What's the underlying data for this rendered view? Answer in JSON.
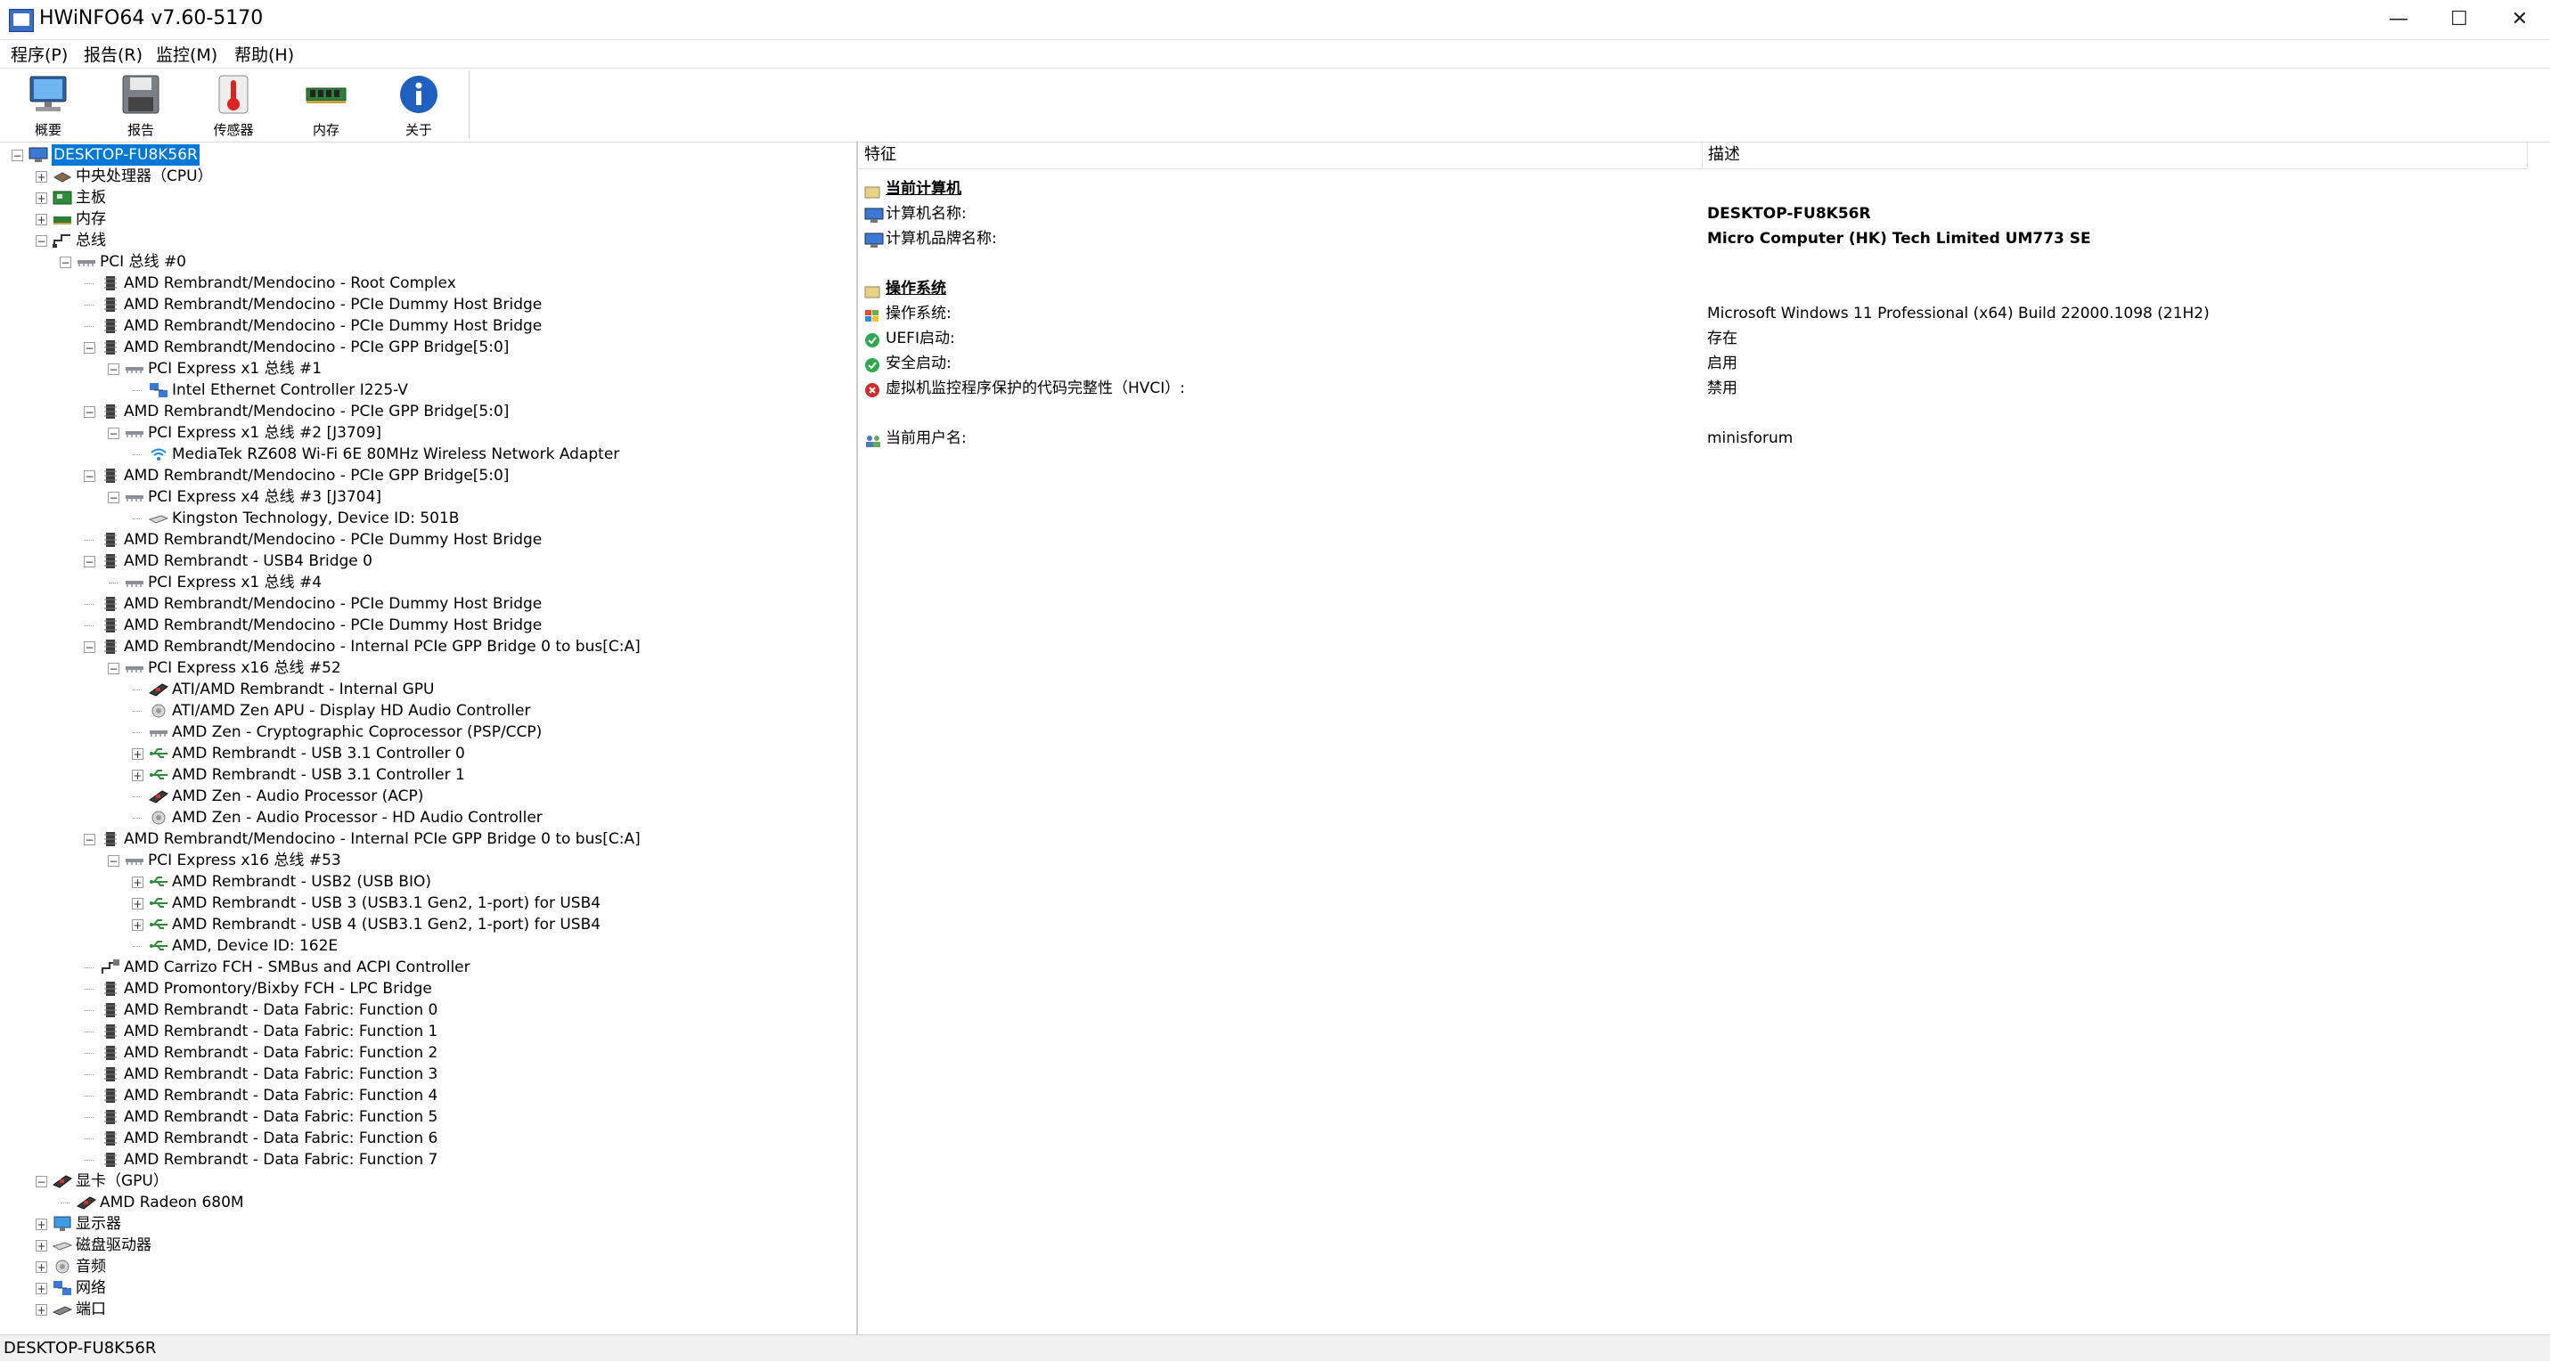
{
  "window": {
    "title": "HWiNFO64 v7.60-5170",
    "minimize": "—",
    "maximize": "☐",
    "close": "✕"
  },
  "menu": [
    "程序(P)",
    "报告(R)",
    "监控(M)",
    "帮助(H)"
  ],
  "toolbar": [
    {
      "label": "概要",
      "icon": "computer-icon"
    },
    {
      "label": "报告",
      "icon": "save-disk-icon"
    },
    {
      "label": "传感器",
      "icon": "thermometer-icon"
    },
    {
      "label": "内存",
      "icon": "memory-module-icon"
    },
    {
      "label": "关于",
      "icon": "info-icon"
    }
  ],
  "tree": [
    {
      "label": "DESKTOP-FU8K56R",
      "level": 0,
      "exp": "-",
      "icon": "computer",
      "selected": true
    },
    {
      "label": "中央处理器（CPU）",
      "level": 1,
      "exp": "+",
      "icon": "cpu"
    },
    {
      "label": "主板",
      "level": 1,
      "exp": "+",
      "icon": "board"
    },
    {
      "label": "内存",
      "level": 1,
      "exp": "+",
      "icon": "ram"
    },
    {
      "label": "总线",
      "level": 1,
      "exp": "-",
      "icon": "bus"
    },
    {
      "label": "PCI 总线 #0",
      "level": 2,
      "exp": "-",
      "icon": "pcibus"
    },
    {
      "label": "AMD Rembrandt/Mendocino - Root Complex",
      "level": 3,
      "exp": "",
      "icon": "chip"
    },
    {
      "label": "AMD Rembrandt/Mendocino - PCIe Dummy Host Bridge",
      "level": 3,
      "exp": "",
      "icon": "chip"
    },
    {
      "label": "AMD Rembrandt/Mendocino - PCIe Dummy Host Bridge",
      "level": 3,
      "exp": "",
      "icon": "chip"
    },
    {
      "label": "AMD Rembrandt/Mendocino - PCIe GPP Bridge[5:0]",
      "level": 3,
      "exp": "-",
      "icon": "chip"
    },
    {
      "label": "PCI Express x1 总线 #1",
      "level": 4,
      "exp": "-",
      "icon": "pcibus"
    },
    {
      "label": "Intel Ethernet Controller I225-V",
      "level": 5,
      "exp": "",
      "icon": "network"
    },
    {
      "label": "AMD Rembrandt/Mendocino - PCIe GPP Bridge[5:0]",
      "level": 3,
      "exp": "-",
      "icon": "chip"
    },
    {
      "label": "PCI Express x1 总线 #2 [J3709]",
      "level": 4,
      "exp": "-",
      "icon": "pcibus"
    },
    {
      "label": "MediaTek RZ608 Wi-Fi 6E 80MHz Wireless Network Adapter",
      "level": 5,
      "exp": "",
      "icon": "wifi"
    },
    {
      "label": "AMD Rembrandt/Mendocino - PCIe GPP Bridge[5:0]",
      "level": 3,
      "exp": "-",
      "icon": "chip"
    },
    {
      "label": "PCI Express x4 总线 #3 [J3704]",
      "level": 4,
      "exp": "-",
      "icon": "pcibus"
    },
    {
      "label": "Kingston Technology, Device ID: 501B",
      "level": 5,
      "exp": "",
      "icon": "disk"
    },
    {
      "label": "AMD Rembrandt/Mendocino - PCIe Dummy Host Bridge",
      "level": 3,
      "exp": "",
      "icon": "chip"
    },
    {
      "label": "AMD Rembrandt - USB4 Bridge 0",
      "level": 3,
      "exp": "-",
      "icon": "chip"
    },
    {
      "label": "PCI Express x1 总线 #4",
      "level": 4,
      "exp": "",
      "icon": "pcibus"
    },
    {
      "label": "AMD Rembrandt/Mendocino - PCIe Dummy Host Bridge",
      "level": 3,
      "exp": "",
      "icon": "chip"
    },
    {
      "label": "AMD Rembrandt/Mendocino - PCIe Dummy Host Bridge",
      "level": 3,
      "exp": "",
      "icon": "chip"
    },
    {
      "label": "AMD Rembrandt/Mendocino - Internal PCIe GPP Bridge 0 to bus[C:A]",
      "level": 3,
      "exp": "-",
      "icon": "chip"
    },
    {
      "label": "PCI Express x16 总线 #52",
      "level": 4,
      "exp": "-",
      "icon": "pcibus"
    },
    {
      "label": "ATI/AMD Rembrandt - Internal GPU",
      "level": 5,
      "exp": "",
      "icon": "gpu"
    },
    {
      "label": "ATI/AMD Zen APU - Display HD Audio Controller",
      "level": 5,
      "exp": "",
      "icon": "audio"
    },
    {
      "label": "AMD Zen - Cryptographic Coprocessor (PSP/CCP)",
      "level": 5,
      "exp": "",
      "icon": "pcibus"
    },
    {
      "label": "AMD Rembrandt - USB 3.1 Controller 0",
      "level": 5,
      "exp": "+",
      "icon": "usb"
    },
    {
      "label": "AMD Rembrandt - USB 3.1 Controller 1",
      "level": 5,
      "exp": "+",
      "icon": "usb"
    },
    {
      "label": "AMD Zen - Audio Processor (ACP)",
      "level": 5,
      "exp": "",
      "icon": "gpu"
    },
    {
      "label": "AMD Zen - Audio Processor - HD Audio Controller",
      "level": 5,
      "exp": "",
      "icon": "audio"
    },
    {
      "label": "AMD Rembrandt/Mendocino - Internal PCIe GPP Bridge 0 to bus[C:A]",
      "level": 3,
      "exp": "-",
      "icon": "chip"
    },
    {
      "label": "PCI Express x16 总线 #53",
      "level": 4,
      "exp": "-",
      "icon": "pcibus"
    },
    {
      "label": "AMD Rembrandt - USB2 (USB BIO)",
      "level": 5,
      "exp": "+",
      "icon": "usb"
    },
    {
      "label": "AMD Rembrandt - USB 3 (USB3.1 Gen2, 1-port) for USB4",
      "level": 5,
      "exp": "+",
      "icon": "usb"
    },
    {
      "label": "AMD Rembrandt - USB 4 (USB3.1 Gen2, 1-port) for USB4",
      "level": 5,
      "exp": "+",
      "icon": "usb"
    },
    {
      "label": "AMD, Device ID: 162E",
      "level": 5,
      "exp": "",
      "icon": "usb"
    },
    {
      "label": "AMD Carrizo FCH - SMBus and ACPI Controller",
      "level": 3,
      "exp": "",
      "icon": "smbus"
    },
    {
      "label": "AMD Promontory/Bixby FCH - LPC Bridge",
      "level": 3,
      "exp": "",
      "icon": "chip"
    },
    {
      "label": "AMD Rembrandt - Data Fabric: Function 0",
      "level": 3,
      "exp": "",
      "icon": "chip"
    },
    {
      "label": "AMD Rembrandt - Data Fabric: Function 1",
      "level": 3,
      "exp": "",
      "icon": "chip"
    },
    {
      "label": "AMD Rembrandt - Data Fabric: Function 2",
      "level": 3,
      "exp": "",
      "icon": "chip"
    },
    {
      "label": "AMD Rembrandt - Data Fabric: Function 3",
      "level": 3,
      "exp": "",
      "icon": "chip"
    },
    {
      "label": "AMD Rembrandt - Data Fabric: Function 4",
      "level": 3,
      "exp": "",
      "icon": "chip"
    },
    {
      "label": "AMD Rembrandt - Data Fabric: Function 5",
      "level": 3,
      "exp": "",
      "icon": "chip"
    },
    {
      "label": "AMD Rembrandt - Data Fabric: Function 6",
      "level": 3,
      "exp": "",
      "icon": "chip"
    },
    {
      "label": "AMD Rembrandt - Data Fabric: Function 7",
      "level": 3,
      "exp": "",
      "icon": "chip"
    },
    {
      "label": "显卡（GPU）",
      "level": 1,
      "exp": "-",
      "icon": "gpu"
    },
    {
      "label": "AMD Radeon 680M",
      "level": 2,
      "exp": "",
      "icon": "gpu"
    },
    {
      "label": "显示器",
      "level": 1,
      "exp": "+",
      "icon": "monitor"
    },
    {
      "label": "磁盘驱动器",
      "level": 1,
      "exp": "+",
      "icon": "disk"
    },
    {
      "label": "音频",
      "level": 1,
      "exp": "+",
      "icon": "audio"
    },
    {
      "label": "网络",
      "level": 1,
      "exp": "+",
      "icon": "network"
    },
    {
      "label": "端口",
      "level": 1,
      "exp": "+",
      "icon": "port"
    }
  ],
  "details": {
    "header_feature": "特征",
    "header_description": "描述",
    "rows": [
      {
        "name": "当前计算机",
        "value": "",
        "style": "section",
        "icon": "folder"
      },
      {
        "name": "计算机名称:",
        "value": "DESKTOP-FU8K56R",
        "style": "boldval",
        "icon": "computer"
      },
      {
        "name": "计算机品牌名称:",
        "value": "Micro Computer (HK) Tech Limited UM773 SE",
        "style": "boldval",
        "icon": "computer"
      },
      {
        "name": "",
        "value": "",
        "style": "blank",
        "icon": ""
      },
      {
        "name": "操作系统",
        "value": "",
        "style": "section",
        "icon": "folder"
      },
      {
        "name": "操作系统:",
        "value": "Microsoft Windows 11 Professional (x64) Build 22000.1098 (21H2)",
        "style": "normal",
        "icon": "windows"
      },
      {
        "name": "UEFI启动:",
        "value": "存在",
        "style": "normal",
        "icon": "ok"
      },
      {
        "name": "安全启动:",
        "value": "启用",
        "style": "normal",
        "icon": "ok"
      },
      {
        "name": "虚拟机监控程序保护的代码完整性（HVCI）:",
        "value": "禁用",
        "style": "normal",
        "icon": "error"
      },
      {
        "name": "",
        "value": "",
        "style": "blank",
        "icon": ""
      },
      {
        "name": "当前用户名:",
        "value": "minisforum",
        "style": "normal",
        "icon": "users"
      }
    ]
  },
  "status_bar": "DESKTOP-FU8K56R",
  "colors": {
    "selection": "#0078d7",
    "ok": "#2fa84f",
    "error": "#d32a2a",
    "usb": "#2e8b3a"
  }
}
